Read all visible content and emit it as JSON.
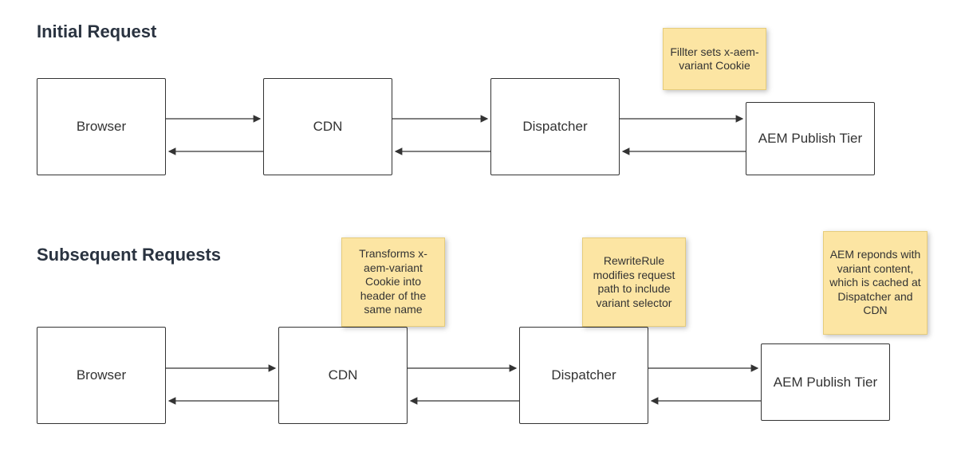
{
  "headings": {
    "initial": "Initial Request",
    "subsequent": "Subsequent Requests"
  },
  "nodes": {
    "browser": "Browser",
    "cdn": "CDN",
    "dispatcher": "Dispatcher",
    "aem_publish": "AEM Publish Tier"
  },
  "notes": {
    "filter_sets": "Fillter sets x-aem-variant Cookie",
    "transforms": "Transforms x-aem-variant Cookie into header of the same name",
    "rewrite": "RewriteRule modifies request path to include variant selector",
    "aem_responds": "AEM reponds with variant content, which is cached at Dispatcher and CDN"
  },
  "colors": {
    "note_bg": "#fce5a3",
    "note_border": "#e6cc7a",
    "box_border": "#333333",
    "heading": "#2a3340"
  }
}
